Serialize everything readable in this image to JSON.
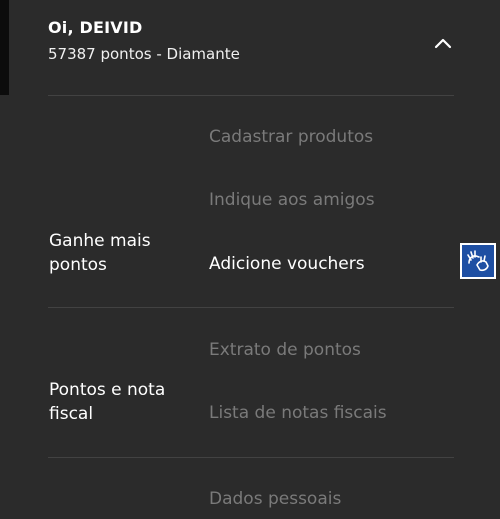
{
  "header": {
    "greeting": "Oi, DEIVID",
    "points_status": "57387 pontos - Diamante"
  },
  "sections": [
    {
      "title": "Ganhe mais pontos",
      "items": [
        {
          "label": "Cadastrar produtos",
          "active": false
        },
        {
          "label": "Indique aos amigos",
          "active": false
        },
        {
          "label": "Adicione vouchers",
          "active": true
        }
      ]
    },
    {
      "title": "Pontos e nota fiscal",
      "items": [
        {
          "label": "Extrato de pontos",
          "active": false
        },
        {
          "label": "Lista de notas fiscais",
          "active": false
        }
      ]
    },
    {
      "title": "",
      "items": [
        {
          "label": "Dados pessoais",
          "active": false
        }
      ]
    }
  ],
  "icons": {
    "collapse": "chevron-up-icon",
    "accessibility": "sign-language-hands-icon"
  },
  "colors": {
    "background": "#2b2b2b",
    "inactive_text": "#7a7a7a",
    "active_text": "#ffffff",
    "accessibility_bg": "#1e4fa3"
  }
}
